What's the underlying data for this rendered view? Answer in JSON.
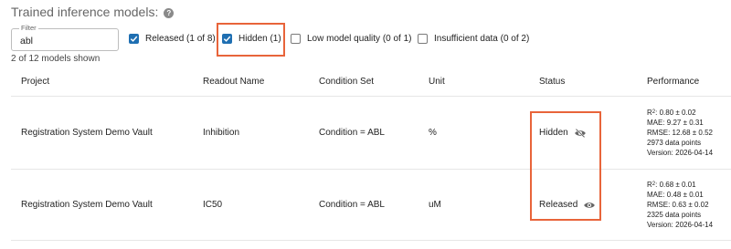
{
  "title": "Trained inference models:",
  "help_icon_glyph": "?",
  "filter": {
    "label": "Filter",
    "value": "abl"
  },
  "checkboxes": [
    {
      "label": "Released (1 of 8)",
      "checked": true
    },
    {
      "label": "Hidden (1)",
      "checked": true
    },
    {
      "label": "Low model quality (0 of 1)",
      "checked": false
    },
    {
      "label": "Insufficient data (0 of 2)",
      "checked": false
    }
  ],
  "count_text": "2 of 12 models shown",
  "columns": [
    "Project",
    "Readout Name",
    "Condition Set",
    "Unit",
    "Status",
    "Performance"
  ],
  "rows": [
    {
      "project": "Registration System Demo Vault",
      "readout": "Inhibition",
      "condition": "Condition = ABL",
      "unit": "%",
      "status": "Hidden",
      "status_icon": "eye-slash-icon",
      "perf": {
        "r2_label": "R",
        "r2_sup": "2",
        "r2_value": ": 0.80 ± 0.02",
        "mae": "MAE: 9.27 ± 0.31",
        "rmse": "RMSE: 12.68 ± 0.52",
        "points": "2973 data points",
        "version": "Version: 2026-04-14"
      }
    },
    {
      "project": "Registration System Demo Vault",
      "readout": "IC50",
      "condition": "Condition = ABL",
      "unit": "uM",
      "status": "Released",
      "status_icon": "eye-icon",
      "perf": {
        "r2_label": "R",
        "r2_sup": "2",
        "r2_value": ": 0.68 ± 0.01",
        "mae": "MAE: 0.48 ± 0.01",
        "rmse": "RMSE: 0.63 ± 0.02",
        "points": "2325 data points",
        "version": "Version: 2026-04-14"
      }
    }
  ],
  "colors": {
    "accent": "#1f6fb2",
    "highlight": "#e8643a"
  }
}
